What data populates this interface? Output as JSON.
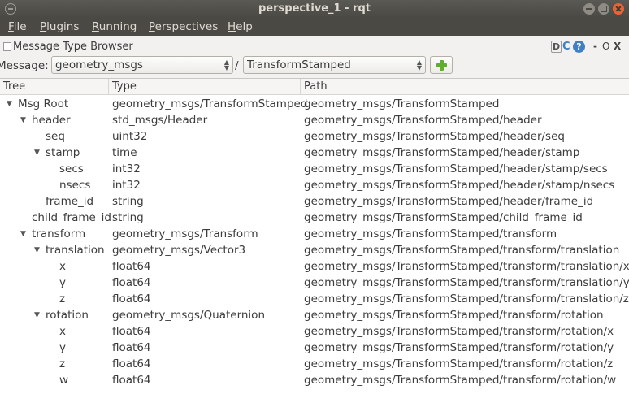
{
  "window": {
    "title": "perspective_1 - rqt"
  },
  "menu": [
    {
      "label": "File",
      "u": "F",
      "rest": "ile"
    },
    {
      "label": "Plugins",
      "u": "P",
      "rest": "lugins"
    },
    {
      "label": "Running",
      "u": "R",
      "rest": "unning"
    },
    {
      "label": "Perspectives",
      "u": "P",
      "rest": "erspectives"
    },
    {
      "label": "Help",
      "u": "H",
      "rest": "elp"
    }
  ],
  "dock": {
    "title": "Message Type Browser",
    "buttons": [
      "D",
      "C",
      "?",
      "-",
      "O",
      "X"
    ]
  },
  "selector": {
    "label": "Message:",
    "package": "geometry_msgs",
    "separator": "/",
    "type": "TransformStamped"
  },
  "columns": [
    "Tree",
    "Type",
    "Path"
  ],
  "rows": [
    {
      "name": "Msg Root",
      "type": "geometry_msgs/TransformStamped",
      "path": "geometry_msgs/TransformStamped",
      "expanded": true
    },
    {
      "name": "header",
      "type": "std_msgs/Header",
      "path": "geometry_msgs/TransformStamped/header",
      "expanded": true
    },
    {
      "name": "seq",
      "type": "uint32",
      "path": "geometry_msgs/TransformStamped/header/seq",
      "expanded": false
    },
    {
      "name": "stamp",
      "type": "time",
      "path": "geometry_msgs/TransformStamped/header/stamp",
      "expanded": true
    },
    {
      "name": "secs",
      "type": "int32",
      "path": "geometry_msgs/TransformStamped/header/stamp/secs",
      "expanded": false
    },
    {
      "name": "nsecs",
      "type": "int32",
      "path": "geometry_msgs/TransformStamped/header/stamp/nsecs",
      "expanded": false
    },
    {
      "name": "frame_id",
      "type": "string",
      "path": "geometry_msgs/TransformStamped/header/frame_id",
      "expanded": false
    },
    {
      "name": "child_frame_id",
      "type": "string",
      "path": "geometry_msgs/TransformStamped/child_frame_id",
      "expanded": false
    },
    {
      "name": "transform",
      "type": "geometry_msgs/Transform",
      "path": "geometry_msgs/TransformStamped/transform",
      "expanded": true
    },
    {
      "name": "translation",
      "type": "geometry_msgs/Vector3",
      "path": "geometry_msgs/TransformStamped/transform/translation",
      "expanded": true
    },
    {
      "name": "x",
      "type": "float64",
      "path": "geometry_msgs/TransformStamped/transform/translation/x",
      "expanded": false
    },
    {
      "name": "y",
      "type": "float64",
      "path": "geometry_msgs/TransformStamped/transform/translation/y",
      "expanded": false
    },
    {
      "name": "z",
      "type": "float64",
      "path": "geometry_msgs/TransformStamped/transform/translation/z",
      "expanded": false
    },
    {
      "name": "rotation",
      "type": "geometry_msgs/Quaternion",
      "path": "geometry_msgs/TransformStamped/transform/rotation",
      "expanded": true
    },
    {
      "name": "x",
      "type": "float64",
      "path": "geometry_msgs/TransformStamped/transform/rotation/x",
      "expanded": false
    },
    {
      "name": "y",
      "type": "float64",
      "path": "geometry_msgs/TransformStamped/transform/rotation/y",
      "expanded": false
    },
    {
      "name": "z",
      "type": "float64",
      "path": "geometry_msgs/TransformStamped/transform/rotation/z",
      "expanded": false
    },
    {
      "name": "w",
      "type": "float64",
      "path": "geometry_msgs/TransformStamped/transform/rotation/w",
      "expanded": false
    }
  ],
  "colors": {
    "titlebar": "#4a4944",
    "close": "#e9633a",
    "add": "#5fae2f",
    "help": "#3f7fc4"
  }
}
